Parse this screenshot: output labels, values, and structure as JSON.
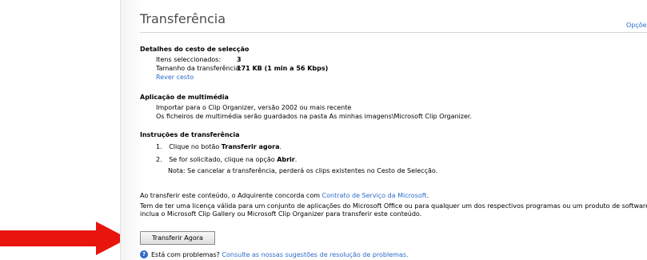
{
  "header": {
    "title": "Transferência",
    "options_link": "Opçõe"
  },
  "basket": {
    "heading": "Detalhes do cesto de selecção",
    "items_label": "Itens seleccionados:",
    "items_value": "3",
    "size_label": "Tamanho da transferência:",
    "size_value": "171 KB  (1 min a 56 Kbps)",
    "review_link": "Rever cesto"
  },
  "media_app": {
    "heading": "Aplicação de multimédia",
    "line1": "Importar para o Clip Organizer, versão 2002 ou mais recente",
    "line2": "Os ficheiros de multimédia serão guardados na pasta As minhas imagens\\Microsoft Clip Organizer."
  },
  "instructions": {
    "heading": "Instruções de transferência",
    "step1_number": "1.",
    "step1_prefix": "Clique no botão ",
    "step1_bold": "Transferir agora",
    "step1_suffix": ".",
    "step2_number": "2.",
    "step2_prefix": "Se for solicitado, clique na opção ",
    "step2_bold": "Abrir",
    "step2_suffix": ".",
    "note": "Nota: Se cancelar a transferência, perderá os clips existentes no Cesto de Selecção."
  },
  "legal": {
    "agree_prefix": "Ao transferir este conteúdo, o Adquirente concorda com ",
    "agree_link": "Contrato de Serviço da Microsoft",
    "agree_suffix": ".",
    "license_line1": "Tem de ter uma licença válida para um conjunto de aplicações do Microsoft Office ou para qualquer um dos respectivos programas ou um produto de software que",
    "license_line2": "inclua o Microsoft Clip Gallery ou Microsoft Clip Organizer para transferir este conteúdo."
  },
  "actions": {
    "download_button": "Transferir Agora"
  },
  "help": {
    "icon_glyph": "?",
    "prefix": "Está com problemas? ",
    "link": "Consulte as nossas sugestões de resolução de problemas."
  },
  "annotation": {
    "arrow_color": "#e8140e"
  },
  "colors": {
    "link": "#2a6cc9",
    "title": "#4d4d4d"
  }
}
